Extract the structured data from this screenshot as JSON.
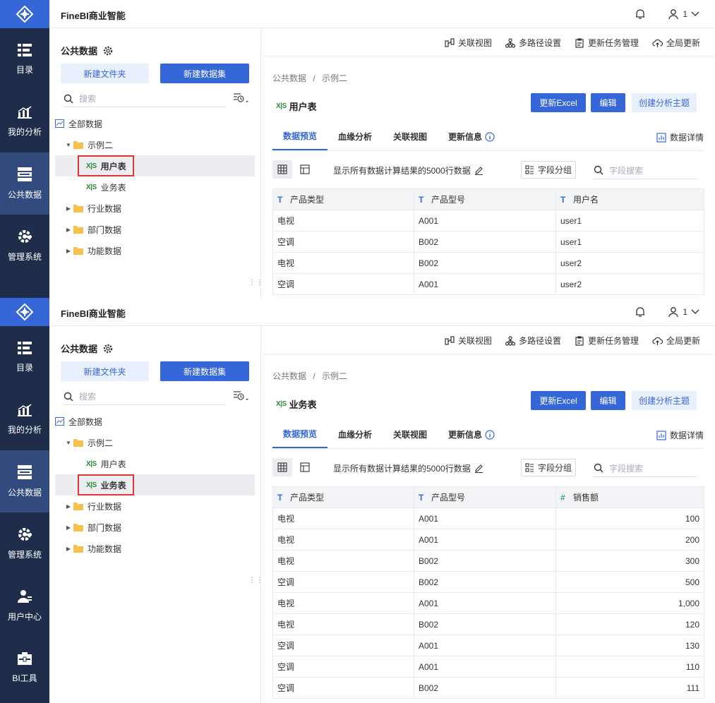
{
  "app": {
    "title": "FineBI商业智能",
    "user": "1"
  },
  "nav": {
    "items": [
      {
        "label": "目录",
        "icon": "catalog-icon"
      },
      {
        "label": "我的分析",
        "icon": "analysis-icon"
      },
      {
        "label": "公共数据",
        "icon": "public-data-icon"
      },
      {
        "label": "管理系统",
        "icon": "settings-gear-icon"
      },
      {
        "label": "用户中心",
        "icon": "user-center-icon"
      },
      {
        "label": "BI工具",
        "icon": "toolbox-icon"
      }
    ]
  },
  "left": {
    "title": "公共数据",
    "new_folder": "新建文件夹",
    "new_dataset": "新建数据集",
    "search_placeholder": "搜索",
    "tree": {
      "root": "全部数据",
      "example": "示例二",
      "user_table": "用户表",
      "biz_table": "业务表",
      "industry": "行业数据",
      "dept": "部门数据",
      "func": "功能数据"
    }
  },
  "toolbar": {
    "linked_view": "关联视图",
    "multi_path": "多路径设置",
    "task_mgmt": "更新任务管理",
    "global_update": "全局更新"
  },
  "common": {
    "breadcrumb_root": "公共数据",
    "breadcrumb_sep": "/",
    "breadcrumb_folder": "示例二",
    "btn_excel": "更新Excel",
    "btn_edit": "编辑",
    "btn_theme": "创建分析主题",
    "tab_preview": "数据预览",
    "tab_lineage": "血缘分析",
    "tab_linked": "关联视图",
    "tab_update": "更新信息",
    "detail": "数据详情",
    "note": "显示所有数据计算结果的5000行数据",
    "group": "字段分组",
    "field_search": "字段搜索"
  },
  "panel1": {
    "table_name": "用户表",
    "columns": [
      "产品类型",
      "产品型号",
      "用户名"
    ],
    "rows": [
      [
        "电视",
        "A001",
        "user1"
      ],
      [
        "空调",
        "B002",
        "user1"
      ],
      [
        "电视",
        "B002",
        "user2"
      ],
      [
        "空调",
        "A001",
        "user2"
      ]
    ]
  },
  "panel2": {
    "table_name": "业务表",
    "columns": [
      "产品类型",
      "产品型号",
      "销售额"
    ],
    "rows": [
      [
        "电视",
        "A001",
        "100"
      ],
      [
        "电视",
        "A001",
        "200"
      ],
      [
        "电视",
        "B002",
        "300"
      ],
      [
        "空调",
        "B002",
        "500"
      ],
      [
        "电视",
        "A001",
        "1,000"
      ],
      [
        "电视",
        "B002",
        "120"
      ],
      [
        "空调",
        "A001",
        "130"
      ],
      [
        "空调",
        "A001",
        "110"
      ],
      [
        "空调",
        "B002",
        "111"
      ]
    ]
  },
  "colors": {
    "nav_bg": "#1f2d4b",
    "accent": "#3567d8",
    "highlight": "#e03434"
  }
}
